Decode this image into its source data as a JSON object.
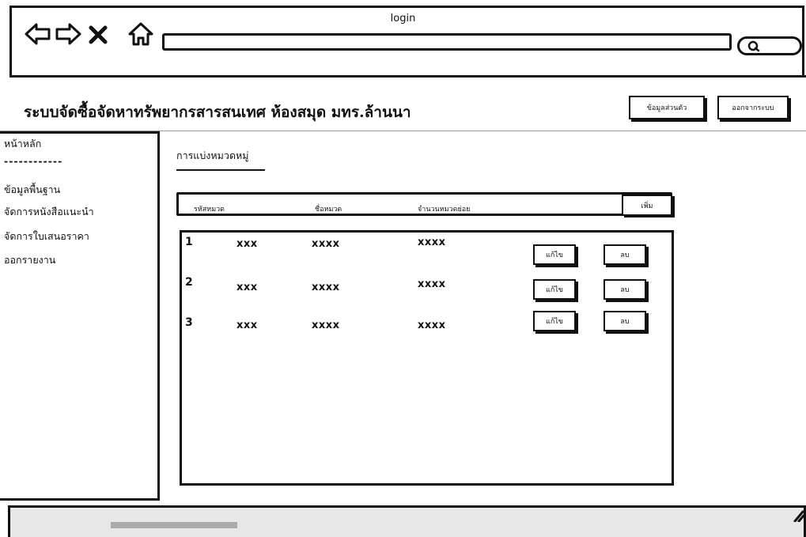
{
  "window": {
    "title": "login"
  },
  "header": {
    "title": "ระบบจัดซื้อจัดหาทรัพยากรสารสนเทศ ห้องสมุด มทร.ล้านนา",
    "profile_button": "ข้อมูลส่วนตัว",
    "logout_button": "ออกจากระบบ"
  },
  "sidebar": {
    "items": [
      {
        "label": "หน้าหลัก"
      },
      {
        "label": "------------"
      },
      {
        "label": "ข้อมูลพื้นฐาน"
      },
      {
        "label": "จัดการหนังสือแนะนำ"
      },
      {
        "label": "จัดการใบเสนอราคา"
      },
      {
        "label": "ออกรายงาน"
      }
    ]
  },
  "main": {
    "section_title": "การแบ่งหมวดหมู่",
    "table": {
      "headers": [
        "รหัสหมวด",
        "ชื่อหมวด",
        "จำนวนหมวดย่อย"
      ],
      "add_label": "เพิ่ม",
      "edit_label": "แก้ไข",
      "delete_label": "ลบ",
      "rows": [
        {
          "no": "1",
          "code": "xxx",
          "name": "xxxx",
          "sub_count": "xxxx"
        },
        {
          "no": "2",
          "code": "xxx",
          "name": "xxxx",
          "sub_count": "xxxx"
        },
        {
          "no": "3",
          "code": "xxx",
          "name": "xxxx",
          "sub_count": "xxxx"
        }
      ]
    }
  },
  "icons": {
    "back": "arrow-left-icon",
    "forward": "arrow-right-icon",
    "stop": "close-icon",
    "home": "home-icon",
    "search": "search-icon",
    "resize": "resize-grip-icon"
  }
}
